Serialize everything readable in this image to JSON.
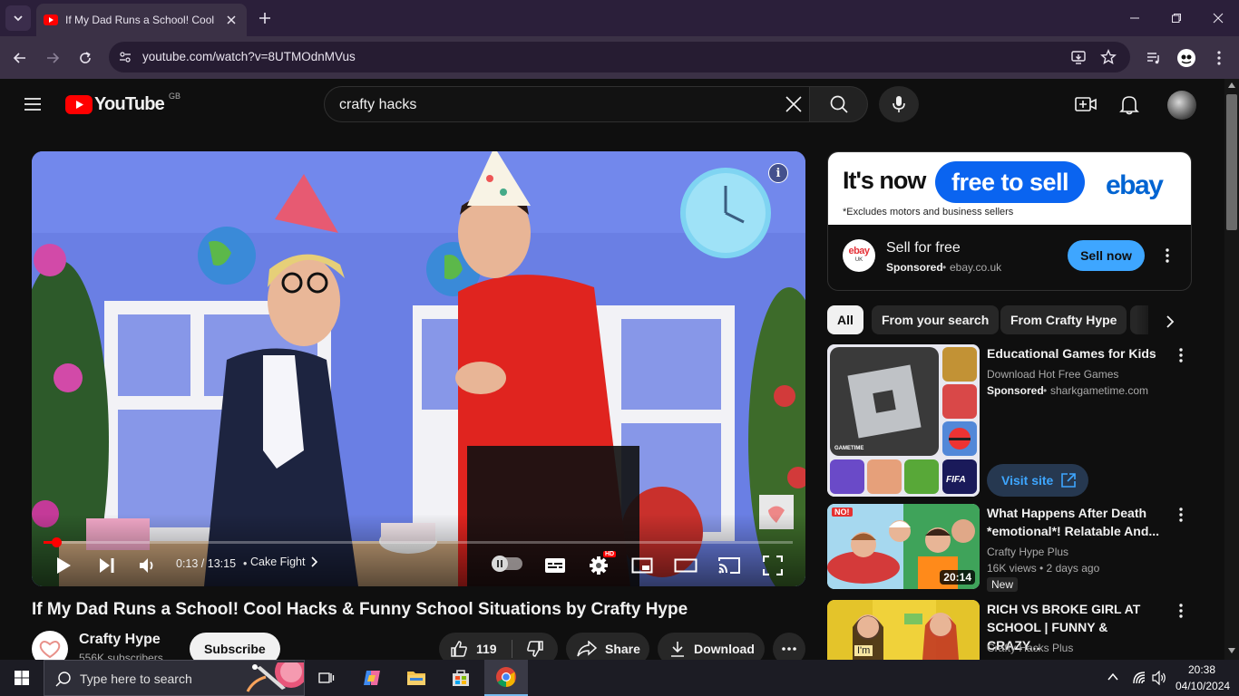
{
  "browser": {
    "tab_title": "If My Dad Runs a School! Cool Hacks & Funny School Situations by Crafty Hype",
    "url": "youtube.com/watch?v=8UTMOdnMVus"
  },
  "youtube": {
    "logo_text": "YouTube",
    "region": "GB",
    "search_query": "crafty hacks"
  },
  "player": {
    "time": "0:13 / 13:15",
    "chapter": "Cake Fight",
    "hd_badge": "HD",
    "progress": 0.0164
  },
  "video": {
    "title": "If My Dad Runs a School! Cool Hacks & Funny School Situations by Crafty Hype",
    "channel": "Crafty Hype",
    "subscribers": "556K subscribers",
    "subscribe_label": "Subscribe",
    "likes": "119",
    "share_label": "Share",
    "download_label": "Download"
  },
  "ad": {
    "banner_prefix": "It's now",
    "banner_highlight": "free to sell",
    "banner_brand": "ebay",
    "banner_footnote": "*Excludes motors and business sellers",
    "badge_text": "ebay",
    "badge_sub": "UK",
    "title": "Sell for free",
    "sponsored": "Sponsored",
    "domain": "ebay.co.uk",
    "cta": "Sell now"
  },
  "chips": [
    "All",
    "From your search",
    "From Crafty Hype"
  ],
  "recommendations": [
    {
      "title": "Educational Games for Kids",
      "line1": "Download Hot Free Games",
      "sponsored": "Sponsored",
      "domain": "sharkgametime.com",
      "cta": "Visit site",
      "thumb_label": "GAMETIME",
      "thumb_tile": "FIFA"
    },
    {
      "title": "What Happens After Death *emotional*! Relatable And...",
      "channel": "Crafty Hype Plus",
      "stats": "16K views • 2 days ago",
      "badge": "New",
      "duration": "20:14",
      "thumb_sign": "NO!"
    },
    {
      "title": "RICH VS BROKE GIRL AT SCHOOL | FUNNY & CRAZY...",
      "channel": "Crafty Hacks Plus",
      "thumb_sign": "I'm"
    }
  ],
  "taskbar": {
    "search_placeholder": "Type here to search",
    "time": "20:38",
    "date": "04/10/2024"
  },
  "colors": {
    "youtube_red": "#ff0000",
    "browser_frame": "#2b1f3a",
    "ebay_blue": "#0a64f0",
    "cta_blue": "#3ea6ff"
  }
}
